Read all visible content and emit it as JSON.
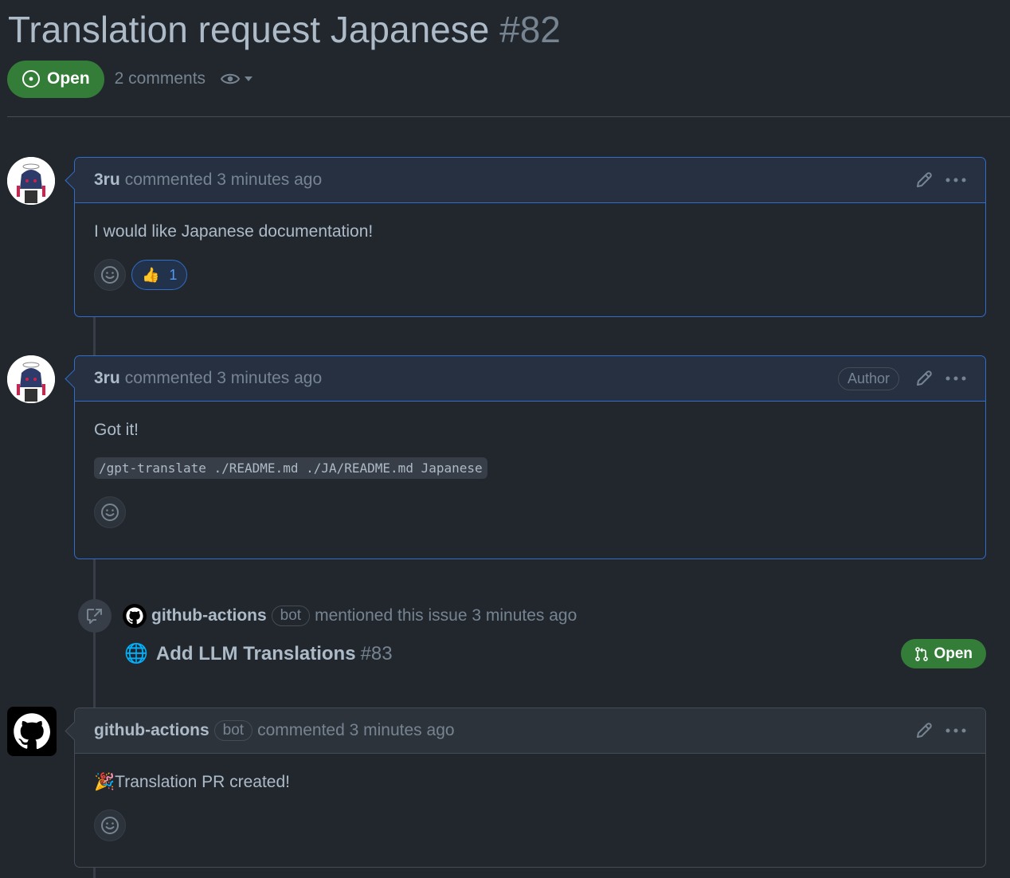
{
  "issue": {
    "title": "Translation request Japanese",
    "number": "#82",
    "state": "Open",
    "comments_count": "2 comments"
  },
  "colors": {
    "background": "#22272e",
    "open_green": "#347d39",
    "accent_blue": "#316dca",
    "muted_text": "#768390"
  },
  "comments": [
    {
      "author": "3ru",
      "action": "commented 3 minutes ago",
      "body": "I would like Japanese documentation!",
      "reactions": [
        {
          "emoji": "👍",
          "count": "1"
        }
      ]
    },
    {
      "author": "3ru",
      "action": "commented 3 minutes ago",
      "role_label": "Author",
      "body": "Got it!",
      "code": "/gpt-translate ./README.md ./JA/README.md Japanese"
    },
    {
      "author": "github-actions",
      "bot_label": "bot",
      "action": "commented 3 minutes ago",
      "emoji": "🎉",
      "body": "Translation PR created!"
    }
  ],
  "event": {
    "actor": "github-actions",
    "bot_label": "bot",
    "action": "mentioned this issue 3 minutes ago",
    "pr_emoji": "🌐",
    "pr_title": "Add LLM Translations",
    "pr_number": "#83",
    "pr_state": "Open"
  }
}
